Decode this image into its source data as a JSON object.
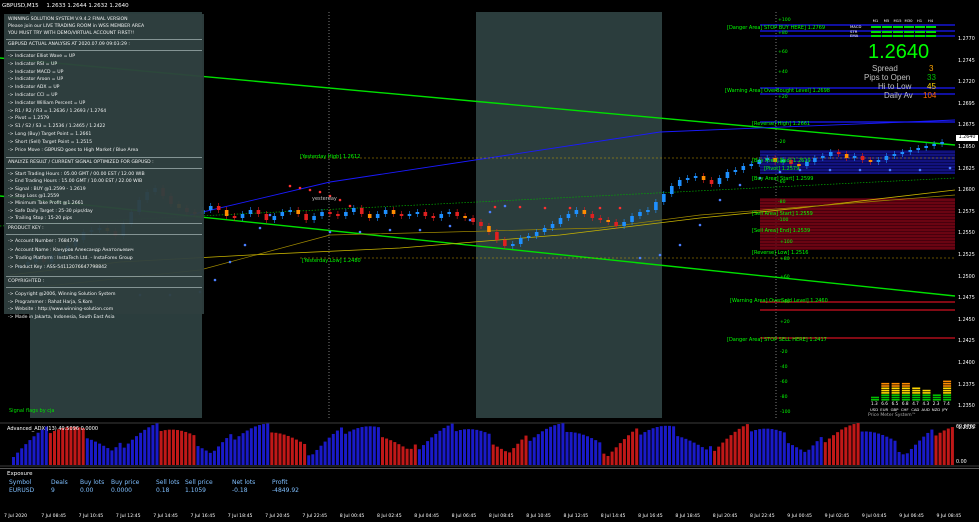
{
  "window": {
    "symbol": "GBPUSD,M15",
    "ohlc": "1.2633 1.2644 1.2632 1.2640"
  },
  "panel": {
    "title": "WINNING SOLUTION SYSTEM V.9.4.2 FINAL VERSION",
    "line2": "Please join our LIVE TRADING ROOM in WSS MEMBER AREA",
    "line3": "YOU MUST TRY WITH DEMO/VIRTUAL ACCOUNT FIRST!!",
    "analysis_header": "GBPUSD ACTUAL ANALYSIS AT 2020.07.09 09:03:29 :",
    "indicators": [
      "-> Indicator Elliot Wave = UP",
      "-> Indicator RSI = UP",
      "-> Indicator MACD = UP",
      "-> Indicator Aroon = UP",
      "-> Indicator ADX = UP",
      "-> Indicator CCI = UP",
      "-> Indicator William Percent = UP",
      "-> R1 / R2 / R3 = 1.2636 / 1.2693 / 1.2764",
      "-> Pivot = 1.2579",
      "-> S1 / S2 / S3 = 1.2536 / 1.2465 / 1.2422",
      "-> Long (Buy) Target Point = 1.2661",
      "-> Short (Sell) Target Point = 1.2515",
      "-> Price Move : GBPUSD goes to High Market / Blue Area"
    ],
    "signal_header": "ANALYZE RESULT / CURRENT SIGNAL OPTIMIZED FOR GBPUSD :",
    "signal_lines": [
      "-> Start Trading Hours : 05.00 GMT / 00.00 EST / 12.00 WIB",
      "-> End Trading Hours : 15.00 GMT / 10.00 EST / 22.00 WIB",
      "-> Signal : BUY @1.2599 - 1.2619",
      "-> Stop Loss @1.2559",
      "-> Minimum Take Profit @1.2661",
      "-> Safe Daily Target : 25-30 pips/day",
      "-> Trailing Stop : 15-20 pips"
    ],
    "product_header": "PRODUCT KEY :",
    "product_lines": [
      "-> Account Number : 7684779",
      "-> Account Name : Кануров Александр Анатольевич",
      "-> Trading Platform : InstaTech Ltd. - InstaForex Group",
      "-> Product Key : ASS-54112076647798842"
    ],
    "copyright_header": "COPYRIGHTED :",
    "copyright_lines": [
      "-> Copyright @2006, Winning Solution System",
      "-> Programmer : Rahat Harja, S.Kom",
      "-> Website : http://www.winning-solution.com",
      "-> Made in Jakarta, Indonesia, South East Asia"
    ]
  },
  "signal_flags": "Signal flags by cja",
  "chart_labels": {
    "yesterday_high": "[Yesterday High] 1.2612",
    "yesterday": "yesterday",
    "yesterday_low": "[Yesterday Low] 1.2480",
    "danger_buy": "[Danger Area] STOP BUY HERE] 1.2769",
    "warning_overbought": "[Warning Area] OverBought Level] 1.2698",
    "reverse_high": "[Reverse] High] 1.2661",
    "buy_area_end": "[Buy Area] End] 1.2619",
    "buy_area_start": "[Buy Area] Start] 1.2599",
    "pivot": "[Pivot] 1.2579",
    "sell_area_start": "[Sell Area] Start] 1.2559",
    "sell_area_end": "[Sell Area] End] 1.2539",
    "reverse_low": "[Reverse] Low] 1.2516",
    "warning_oversold": "[Warning Area] OverSold Level] 1.2460",
    "danger_sell": "[Danger Area] STOP SELL HERE] 1.2417"
  },
  "price_axis": [
    "1.2770",
    "1.2745",
    "1.2720",
    "1.2695",
    "1.2675",
    "1.2650",
    "1.2625",
    "1.2600",
    "1.2575",
    "1.2550",
    "1.2525",
    "1.2500",
    "1.2475",
    "1.2450",
    "1.2425",
    "1.2400",
    "1.2375",
    "1.2350",
    "1.2325"
  ],
  "current_price_tag": "1.2640",
  "pip_scale": [
    "+100",
    "+80",
    "+60",
    "+40",
    "+20",
    "-20",
    "-40",
    "-60",
    "-80",
    "-100",
    "+100",
    "+80",
    "+60",
    "+40",
    "+20",
    "-20",
    "-40",
    "-60",
    "-80",
    "-100"
  ],
  "info": {
    "big_price": "1.2640",
    "spread_label": "Spread",
    "spread_value": "3",
    "pips_open_label": "Pips to Open",
    "pips_open_value": "33",
    "hilo_label": "Hi to Low",
    "hilo_value": "45",
    "daily_av_label": "Daily Av",
    "daily_av_value": "104"
  },
  "maco": {
    "timeframes": [
      "M1",
      "M5",
      "M15",
      "M30",
      "H1",
      "H4"
    ],
    "labels": [
      "MACD",
      "STR",
      "EMA"
    ]
  },
  "strength": {
    "currencies": [
      "USD",
      "EUR",
      "GBP",
      "CHF",
      "CAD",
      "AUD",
      "NZD",
      "JPY"
    ],
    "values": [
      "1.3",
      "6.6",
      "6.5",
      "6.8",
      "4.7",
      "4.3",
      "2.3",
      "7.4"
    ],
    "caption": "Price Meter System™"
  },
  "adx": {
    "title": "Advanced_ADX (13) 49.5096 0.0000",
    "top": "69.8762",
    "bottom": "0.00"
  },
  "exposure": {
    "title": "Exposure",
    "headers": [
      "Symbol",
      "Deals",
      "Buy lots",
      "Buy price",
      "Sell lots",
      "Sell price",
      "Net lots",
      "Profit"
    ],
    "row": [
      "EURUSD",
      "9",
      "0.00",
      "0.0000",
      "0.18",
      "1.1059",
      "-0.18",
      "-4849.92"
    ]
  },
  "time_axis": [
    "7 Jul 2020",
    "7 Jul 08:45",
    "7 Jul 10:45",
    "7 Jul 12:45",
    "7 Jul 14:45",
    "7 Jul 16:45",
    "7 Jul 18:45",
    "7 Jul 20:45",
    "7 Jul 22:45",
    "8 Jul 00:45",
    "8 Jul 02:45",
    "8 Jul 04:45",
    "8 Jul 06:45",
    "8 Jul 08:45",
    "8 Jul 10:45",
    "8 Jul 12:45",
    "8 Jul 14:45",
    "8 Jul 16:45",
    "8 Jul 18:45",
    "8 Jul 20:45",
    "8 Jul 22:45",
    "9 Jul 00:45",
    "9 Jul 02:45",
    "9 Jul 04:45",
    "9 Jul 06:45",
    "9 Jul 08:45"
  ],
  "colors": {
    "session": "#2b3d3d",
    "bull": "#1e90ff",
    "bear": "#e02020",
    "green_line": "#00e000",
    "yellow_line": "#c8b400",
    "navy_line": "#1a1aff"
  }
}
